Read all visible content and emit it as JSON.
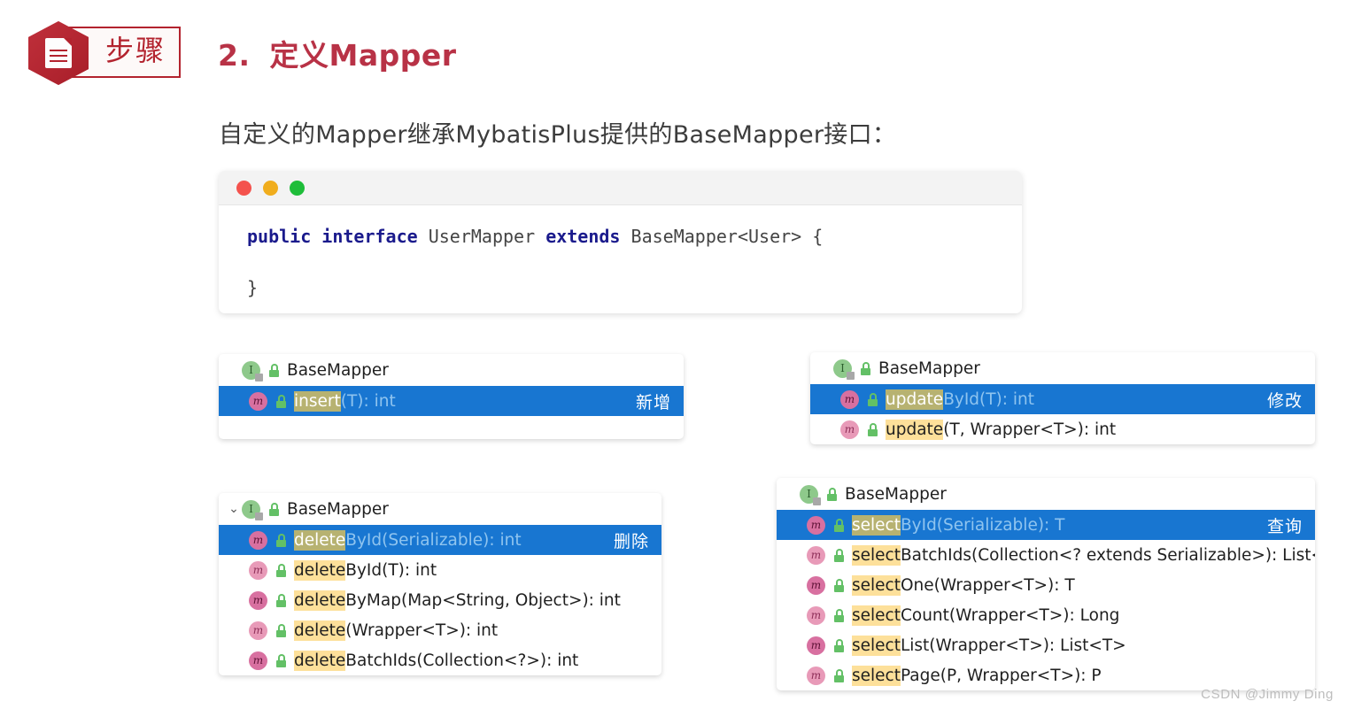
{
  "header": {
    "badge_label": "步骤",
    "badge_icon": "document-icon",
    "title_number": "2.",
    "title_text": "定义Mapper"
  },
  "intro": {
    "text": "自定义的Mapper继承MybatisPlus提供的BaseMapper接口："
  },
  "code_window": {
    "traffic_lights": [
      "close-red",
      "minimize-yellow",
      "maximize-green"
    ],
    "lines": {
      "kw_public": "public",
      "kw_interface": "interface",
      "type_name": "UserMapper",
      "kw_extends": "extends",
      "super_type": "BaseMapper<User> {",
      "close_brace": "}"
    }
  },
  "panels": [
    {
      "id": "insert",
      "header": "BaseMapper",
      "has_chevron": false,
      "tag": "新增",
      "rows": [
        {
          "highlight": "insert",
          "rest": "(T): int",
          "selected": true
        }
      ],
      "trailing_blank": true
    },
    {
      "id": "update",
      "header": "BaseMapper",
      "has_chevron": false,
      "tag": "修改",
      "rows": [
        {
          "highlight": "update",
          "rest": "ById(T): int",
          "selected": true
        },
        {
          "highlight": "update",
          "rest": "(T, Wrapper<T>): int",
          "selected": false
        }
      ],
      "trailing_blank": false
    },
    {
      "id": "delete",
      "header": "BaseMapper",
      "has_chevron": true,
      "chevron_glyph": "⌄",
      "tag": "删除",
      "rows": [
        {
          "highlight": "delete",
          "rest": "ById(Serializable): int",
          "selected": true
        },
        {
          "highlight": "delete",
          "rest": "ById(T): int",
          "selected": false
        },
        {
          "highlight": "delete",
          "rest": "ByMap(Map<String, Object>): int",
          "selected": false
        },
        {
          "highlight": "delete",
          "rest": "(Wrapper<T>): int",
          "selected": false
        },
        {
          "highlight": "delete",
          "rest": "BatchIds(Collection<?>): int",
          "selected": false
        }
      ],
      "trailing_blank": false
    },
    {
      "id": "select",
      "header": "BaseMapper",
      "has_chevron": false,
      "tag": "查询",
      "rows": [
        {
          "highlight": "select",
          "rest": "ById(Serializable): T",
          "selected": true
        },
        {
          "highlight": "select",
          "rest": "BatchIds(Collection<? extends Serializable>): List<T>",
          "selected": false
        },
        {
          "highlight": "select",
          "rest": "One(Wrapper<T>): T",
          "selected": false
        },
        {
          "highlight": "select",
          "rest": "Count(Wrapper<T>): Long",
          "selected": false
        },
        {
          "highlight": "select",
          "rest": "List(Wrapper<T>): List<T>",
          "selected": false
        },
        {
          "highlight": "select",
          "rest": "Page(P, Wrapper<T>): P",
          "selected": false
        }
      ],
      "trailing_blank": false
    }
  ],
  "icons": {
    "interface_letter": "I",
    "method_letter": "m",
    "lock_icon": "lock-icon"
  },
  "watermark": "CSDN @Jimmy Ding",
  "colors": {
    "brand_red": "#b3232e",
    "title_red": "#b83246",
    "selection_blue": "#1876d1",
    "highlight_amber": "#fde09a",
    "highlight_olive": "#b7b271",
    "keyword_navy": "#1a1a8c"
  }
}
